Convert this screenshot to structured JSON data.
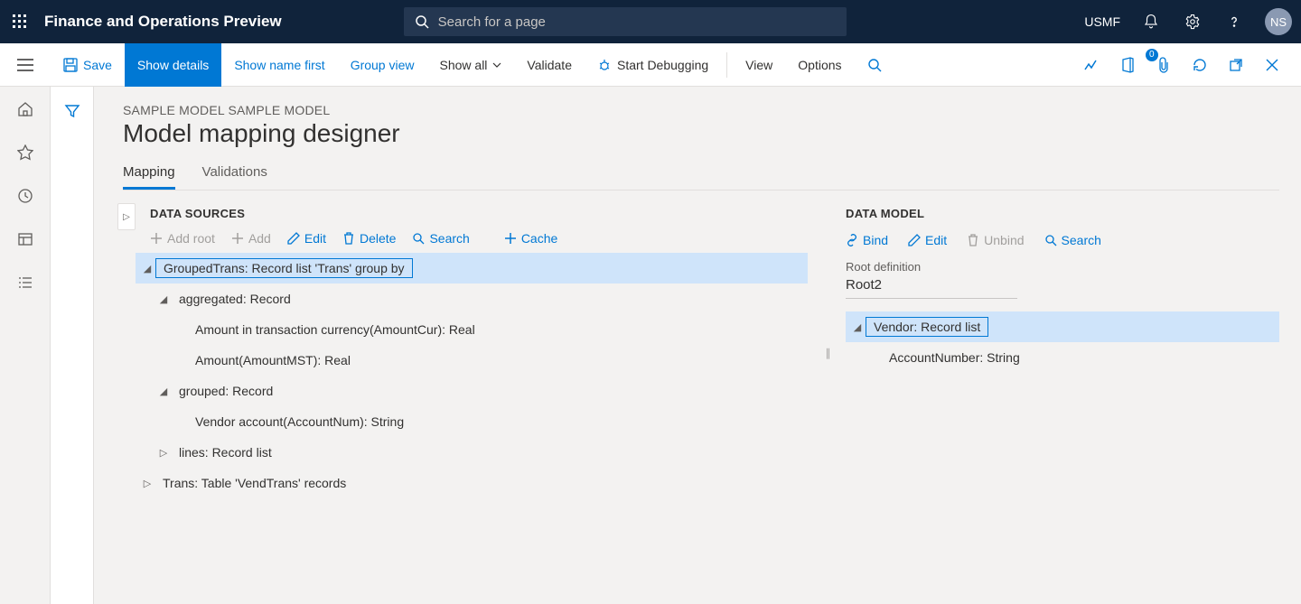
{
  "topbar": {
    "app_title": "Finance and Operations Preview",
    "search_placeholder": "Search for a page",
    "company": "USMF",
    "avatar": "NS"
  },
  "actionbar": {
    "save": "Save",
    "show_details": "Show details",
    "show_name_first": "Show name first",
    "group_view": "Group view",
    "show_all": "Show all",
    "validate": "Validate",
    "start_debugging": "Start Debugging",
    "view": "View",
    "options": "Options",
    "badge": "0"
  },
  "page": {
    "breadcrumb": "SAMPLE MODEL SAMPLE MODEL",
    "title": "Model mapping designer"
  },
  "tabs": {
    "mapping": "Mapping",
    "validations": "Validations"
  },
  "ds": {
    "heading": "DATA SOURCES",
    "tools": {
      "add_root": "Add root",
      "add": "Add",
      "edit": "Edit",
      "delete": "Delete",
      "search": "Search",
      "cache": "Cache"
    },
    "tree": {
      "n1": "GroupedTrans: Record list 'Trans' group by",
      "n2": "aggregated: Record",
      "n3": "Amount in transaction currency(AmountCur): Real",
      "n4": "Amount(AmountMST): Real",
      "n5": "grouped: Record",
      "n6": "Vendor account(AccountNum): String",
      "n7": "lines: Record list",
      "n8": "Trans: Table 'VendTrans' records"
    }
  },
  "dm": {
    "heading": "DATA MODEL",
    "tools": {
      "bind": "Bind",
      "edit": "Edit",
      "unbind": "Unbind",
      "search": "Search"
    },
    "root_label": "Root definition",
    "root_value": "Root2",
    "tree": {
      "n1": "Vendor: Record list",
      "n2": "AccountNumber: String"
    }
  }
}
